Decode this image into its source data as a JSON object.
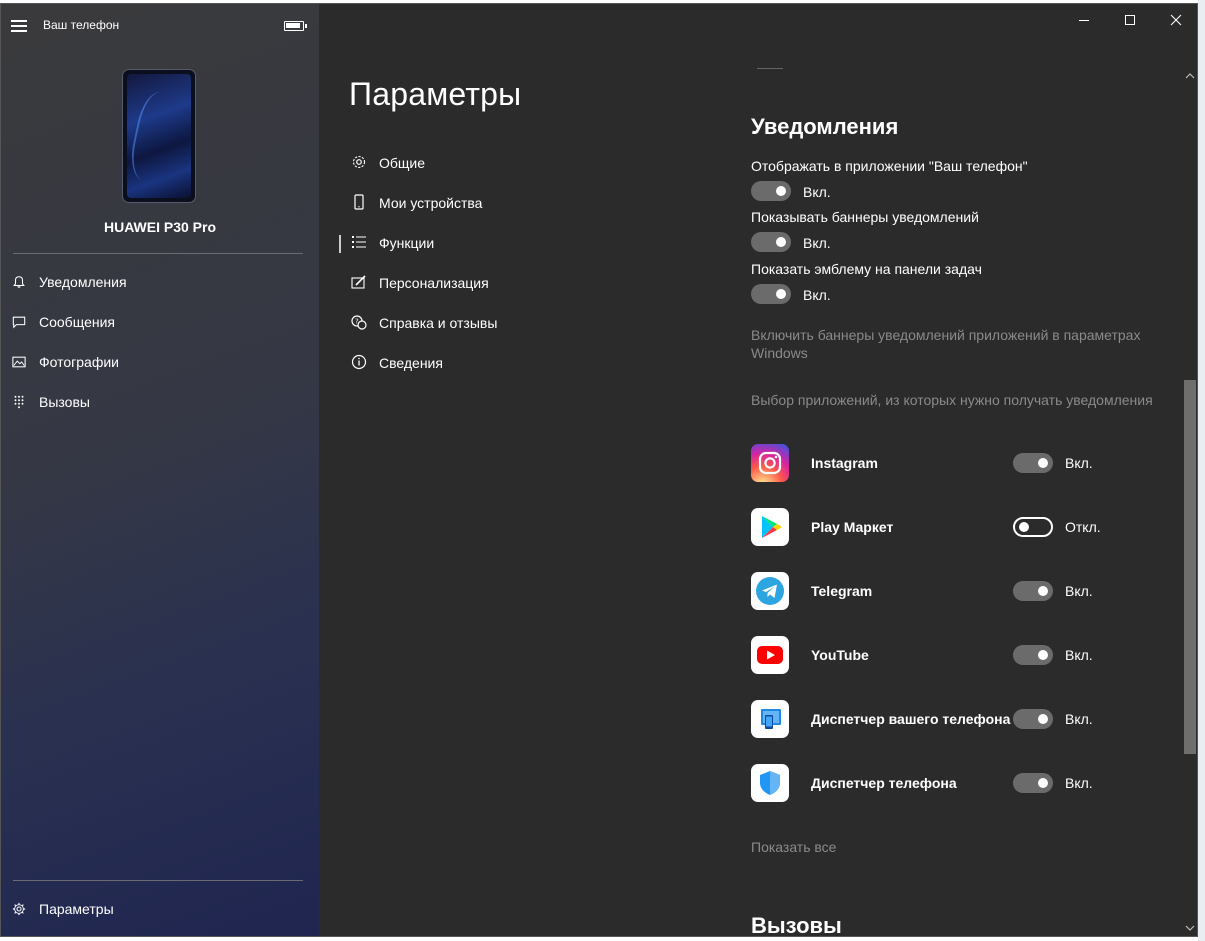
{
  "window": {
    "app_title": "Ваш телефон",
    "device_name": "HUAWEI P30 Pro"
  },
  "sidebar": {
    "items": [
      {
        "label": "Уведомления",
        "icon": "bell-icon"
      },
      {
        "label": "Сообщения",
        "icon": "chat-icon"
      },
      {
        "label": "Фотографии",
        "icon": "photo-icon"
      },
      {
        "label": "Вызовы",
        "icon": "dialpad-icon"
      }
    ],
    "settings_label": "Параметры"
  },
  "settings_menu": {
    "title": "Параметры",
    "items": [
      {
        "label": "Общие",
        "icon": "gear-icon"
      },
      {
        "label": "Мои устройства",
        "icon": "phone-icon"
      },
      {
        "label": "Функции",
        "icon": "list-icon",
        "selected": true
      },
      {
        "label": "Персонализация",
        "icon": "brush-icon"
      },
      {
        "label": "Справка и отзывы",
        "icon": "help-icon"
      },
      {
        "label": "Сведения",
        "icon": "info-icon"
      }
    ]
  },
  "notifications": {
    "heading": "Уведомления",
    "options": [
      {
        "label": "Отображать в приложении \"Ваш телефон\"",
        "state": "Вкл."
      },
      {
        "label": "Показывать баннеры уведомлений",
        "state": "Вкл."
      },
      {
        "label": "Показать эмблему на панели задач",
        "state": "Вкл."
      }
    ],
    "windows_link": "Включить баннеры уведомлений приложений в параметрах Windows",
    "apps_caption": "Выбор приложений, из которых нужно получать уведомления",
    "apps": [
      {
        "name": "Instagram",
        "state": "Вкл.",
        "on": true,
        "icon": "instagram-icon"
      },
      {
        "name": "Play Маркет",
        "state": "Откл.",
        "on": false,
        "icon": "play-market-icon"
      },
      {
        "name": "Telegram",
        "state": "Вкл.",
        "on": true,
        "icon": "telegram-icon"
      },
      {
        "name": "YouTube",
        "state": "Вкл.",
        "on": true,
        "icon": "youtube-icon"
      },
      {
        "name": "Диспетчер вашего телефона",
        "state": "Вкл.",
        "on": true,
        "icon": "phone-companion-icon"
      },
      {
        "name": "Диспетчер телефона",
        "state": "Вкл.",
        "on": true,
        "icon": "phone-manager-icon"
      }
    ],
    "show_all": "Показать все"
  },
  "calls": {
    "heading": "Вызовы"
  },
  "colors": {
    "background": "#2b2b2b",
    "toggle_on": "#6b6b6b",
    "muted_text": "#8a8a8a"
  }
}
